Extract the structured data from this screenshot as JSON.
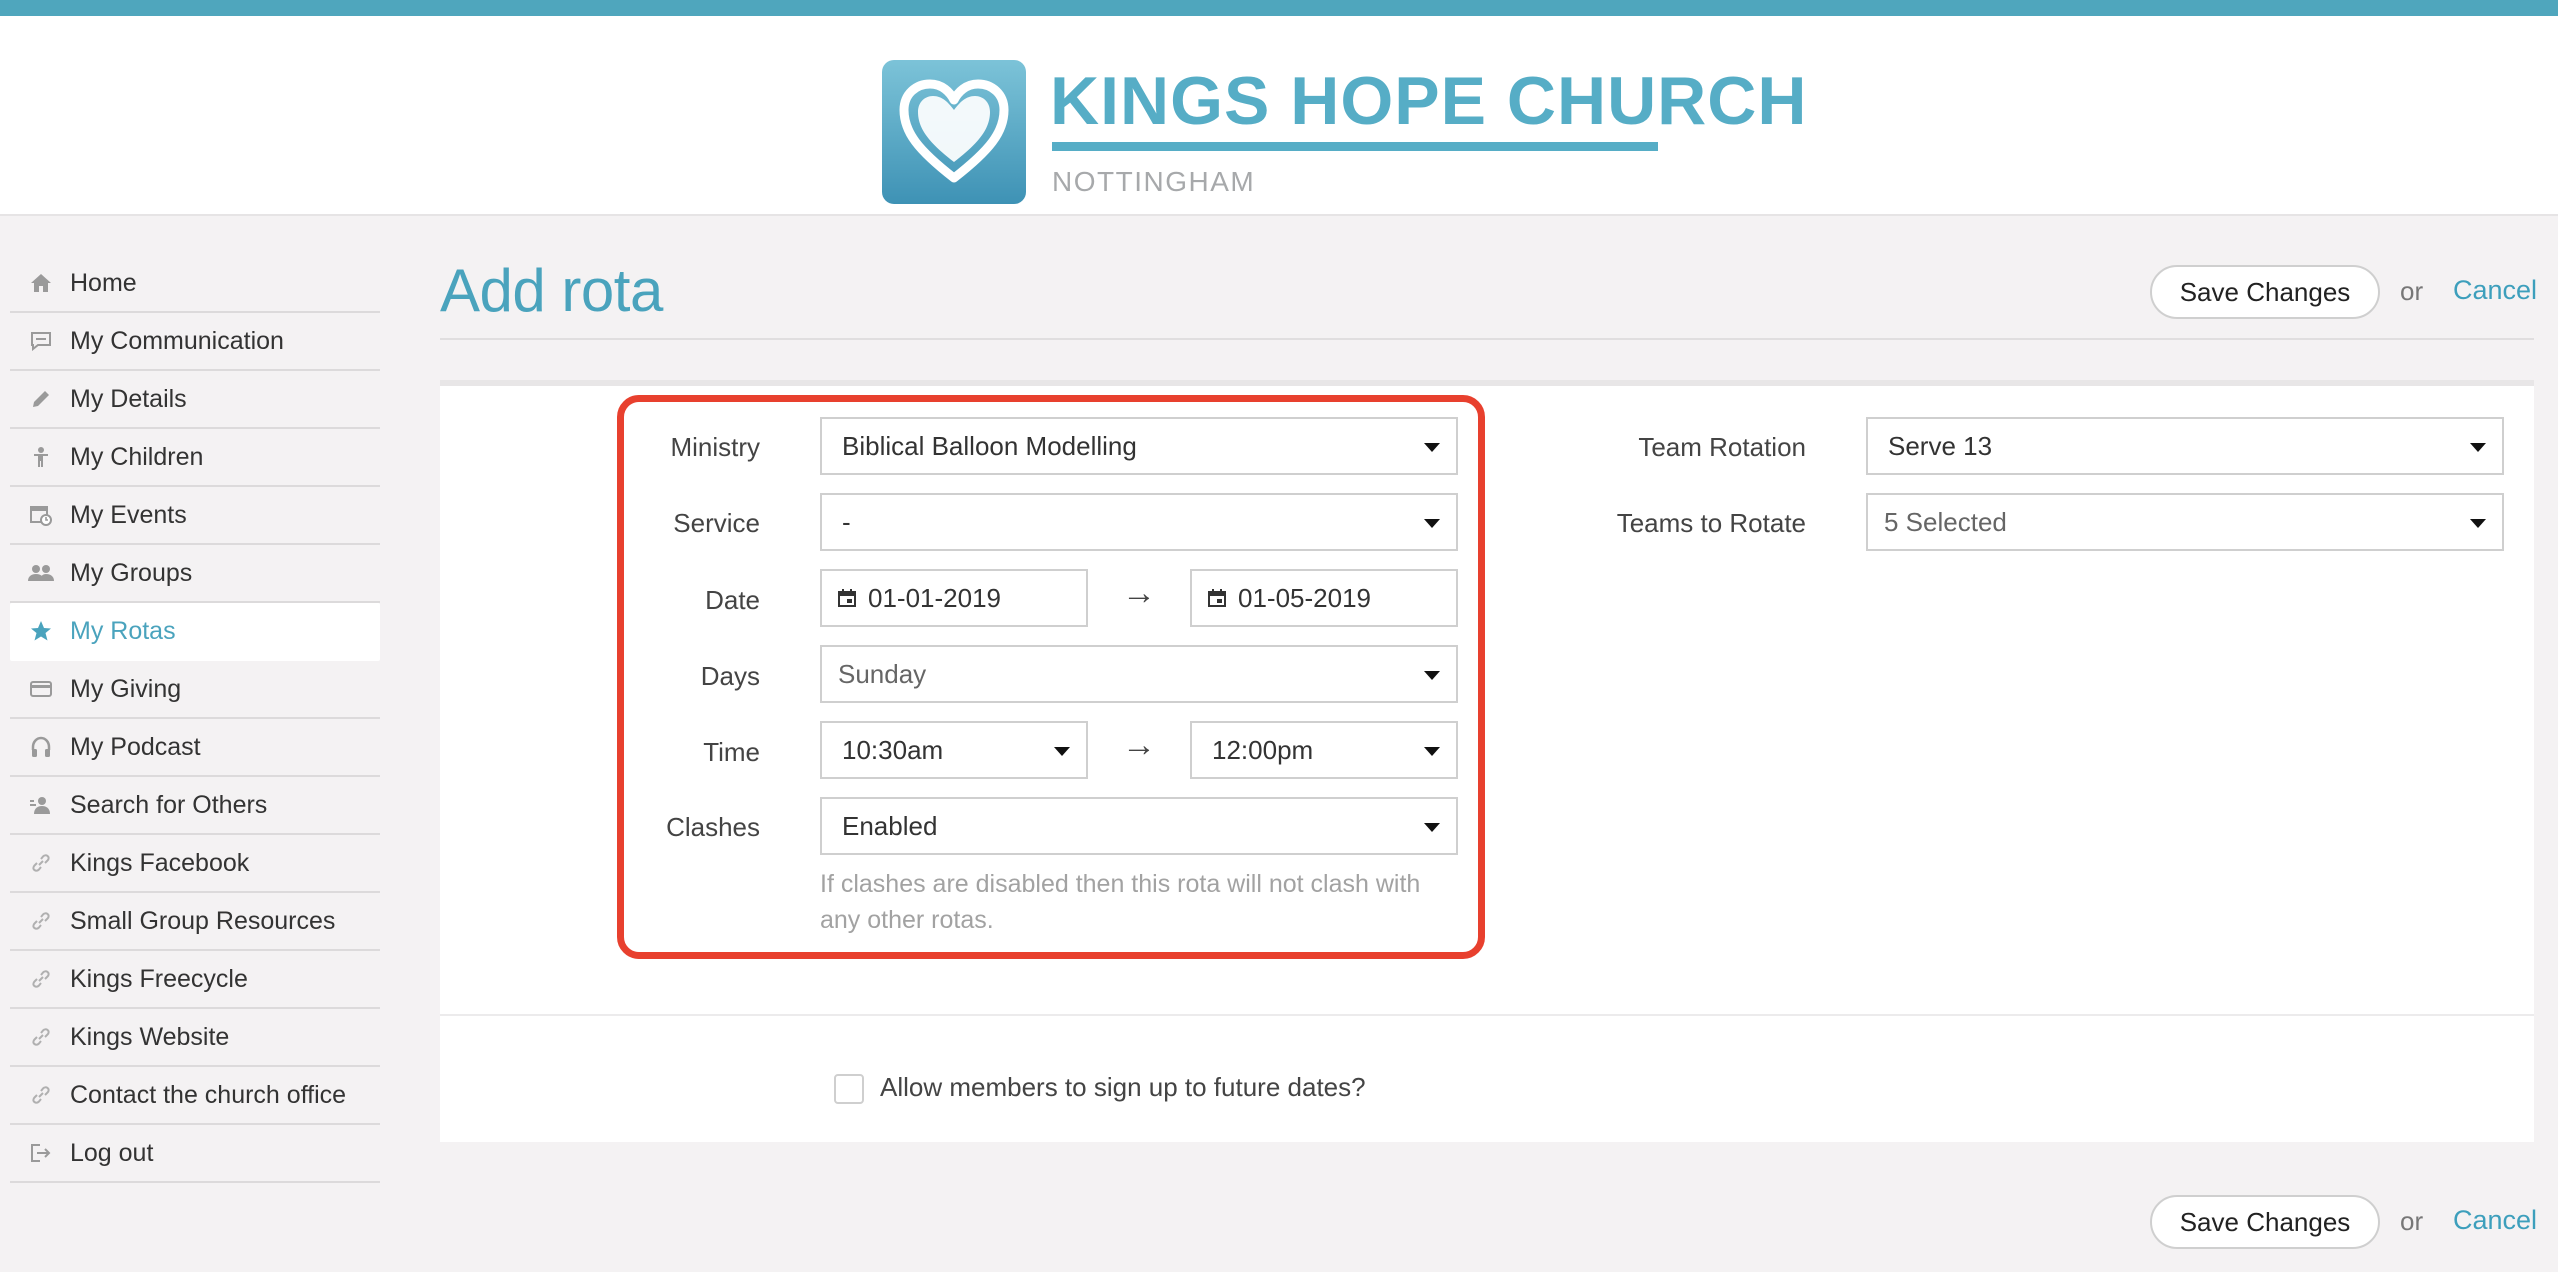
{
  "brand": {
    "name": "KINGS HOPE CHURCH",
    "location": "NOTTINGHAM",
    "accent_color": "#4aa3bd",
    "icon": "heart-logo-icon"
  },
  "sidebar": {
    "items": [
      {
        "label": "Home",
        "icon": "home-icon",
        "active": false
      },
      {
        "label": "My Communication",
        "icon": "chat-icon",
        "active": false
      },
      {
        "label": "My Details",
        "icon": "pencil-icon",
        "active": false
      },
      {
        "label": "My Children",
        "icon": "child-icon",
        "active": false
      },
      {
        "label": "My Events",
        "icon": "calendar-clock-icon",
        "active": false
      },
      {
        "label": "My Groups",
        "icon": "group-icon",
        "active": false
      },
      {
        "label": "My Rotas",
        "icon": "star-icon",
        "active": true
      },
      {
        "label": "My Giving",
        "icon": "card-icon",
        "active": false
      },
      {
        "label": "My Podcast",
        "icon": "headphones-icon",
        "active": false
      },
      {
        "label": "Search for Others",
        "icon": "person-search-icon",
        "active": false
      },
      {
        "label": "Kings Facebook",
        "icon": "link-icon",
        "active": false
      },
      {
        "label": "Small Group Resources",
        "icon": "link-icon",
        "active": false
      },
      {
        "label": "Kings Freecycle",
        "icon": "link-icon",
        "active": false
      },
      {
        "label": "Kings Website",
        "icon": "link-icon",
        "active": false
      },
      {
        "label": "Contact the church office",
        "icon": "link-icon",
        "active": false
      },
      {
        "label": "Log out",
        "icon": "logout-icon",
        "active": false
      }
    ]
  },
  "page": {
    "title": "Add rota",
    "save_label": "Save Changes",
    "or_text": "or",
    "cancel_label": "Cancel"
  },
  "form": {
    "ministry": {
      "label": "Ministry",
      "value": "Biblical Balloon Modelling"
    },
    "service": {
      "label": "Service",
      "value": "-"
    },
    "date": {
      "label": "Date",
      "start": "01-01-2019",
      "end": "01-05-2019",
      "separator": "→"
    },
    "days": {
      "label": "Days",
      "value": "Sunday"
    },
    "time": {
      "label": "Time",
      "start": "10:30am",
      "end": "12:00pm",
      "separator": "→"
    },
    "clashes": {
      "label": "Clashes",
      "value": "Enabled",
      "help": "If clashes are disabled then this rota will not clash with any other rotas."
    },
    "team_rotation": {
      "label": "Team Rotation",
      "value": "Serve 13"
    },
    "teams_to_rotate": {
      "label": "Teams to Rotate",
      "value": "5 Selected"
    },
    "allow_signup": {
      "label": "Allow members to sign up to future dates?",
      "checked": false
    }
  },
  "highlight_color": "#e8402e"
}
